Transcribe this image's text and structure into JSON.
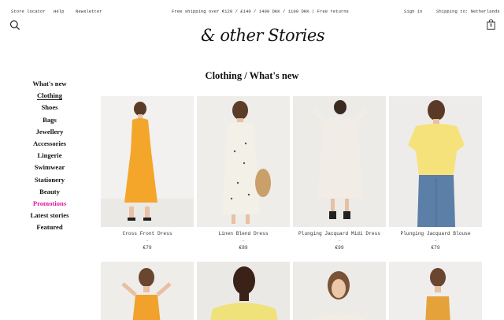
{
  "topbar": {
    "store_locator": "Store locator",
    "help": "Help",
    "newsletter": "Newsletter",
    "shipping_notice": "Free shipping over €120 / £140 / 1400 DKK / 1100 DKK | Free returns",
    "sign_in": "Sign in",
    "shipping_to": "Shipping to: Netherlands"
  },
  "header": {
    "logo_text": "& other Stories",
    "bag_count": "0"
  },
  "page": {
    "title": "Clothing / What's new"
  },
  "sidebar": {
    "items": [
      {
        "label": "What's new"
      },
      {
        "label": "Clothing"
      },
      {
        "label": "Shoes"
      },
      {
        "label": "Bags"
      },
      {
        "label": "Jewellery"
      },
      {
        "label": "Accessories"
      },
      {
        "label": "Lingerie"
      },
      {
        "label": "Swimwear"
      },
      {
        "label": "Stationery"
      },
      {
        "label": "Beauty"
      },
      {
        "label": "Promotions"
      },
      {
        "label": "Latest stories"
      },
      {
        "label": "Featured"
      }
    ],
    "promo_color": "#e01ba0"
  },
  "products": [
    {
      "name": "Cross Front Dress",
      "dash": "–",
      "price": "€79",
      "garment_color": "#f4a62a"
    },
    {
      "name": "Linen Blend Dress",
      "dash": "–",
      "price": "€89",
      "garment_color": "#f3f0e8"
    },
    {
      "name": "Plunging Jacquard Midi Dress",
      "dash": "–",
      "price": "€99",
      "garment_color": "#f1ede6"
    },
    {
      "name": "Plunging Jacquard Blouse",
      "dash": "–",
      "price": "€79",
      "garment_color": "#f6e27a"
    }
  ],
  "products_row2": [
    {
      "garment_color": "#f0a22c"
    },
    {
      "garment_color": "#efe27a"
    },
    {
      "garment_color": "#f2ede4"
    },
    {
      "garment_color": "#e5a23a"
    }
  ]
}
